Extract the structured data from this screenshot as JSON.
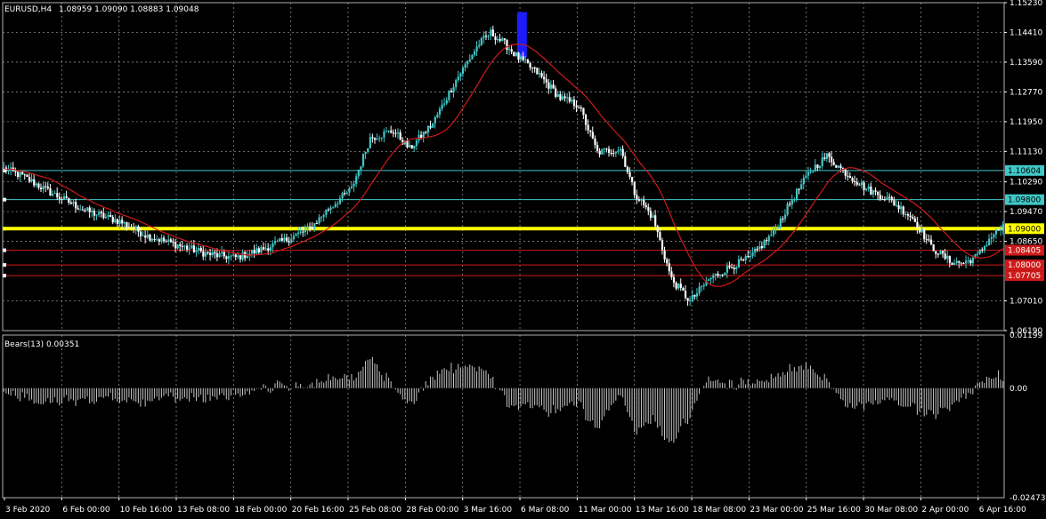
{
  "header": {
    "symbol_timeframe": "EURUSD,H4",
    "ohlc": "1.08959 1.09090 1.08883 1.09048"
  },
  "indicator": {
    "label": "Bears(13) 0.00351"
  },
  "colors": {
    "background": "#000000",
    "grid": "#8a8a8a",
    "bull": "#41c7c7",
    "bear": "#ffffff",
    "ma": "#d01a1a",
    "hline_cyan": "#41c7c7",
    "hline_yellow": "#ffff00",
    "hline_red": "#d01a1a",
    "highlight": "#1c1cff"
  },
  "chart_data": [
    {
      "type": "line",
      "series_kind": "candlestick",
      "ylim": [
        1.0619,
        1.1523
      ],
      "y_ticks": [
        "1.15230",
        "1.14410",
        "1.13590",
        "1.12770",
        "1.11950",
        "1.11130",
        "1.10290",
        "1.09470",
        "1.08650",
        "1.07010",
        "1.06190"
      ],
      "x_ticks": [
        "3 Feb 2020",
        "6 Feb 00:00",
        "10 Feb 16:00",
        "13 Feb 08:00",
        "18 Feb 00:00",
        "20 Feb 16:00",
        "25 Feb 08:00",
        "28 Feb 00:00",
        "3 Mar 16:00",
        "6 Mar 08:00",
        "11 Mar 00:00",
        "13 Mar 16:00",
        "18 Mar 08:00",
        "23 Mar 00:00",
        "25 Mar 16:00",
        "30 Mar 08:00",
        "2 Apr 00:00",
        "6 Apr 16:00"
      ],
      "anchors": [
        [
          0,
          1.1065
        ],
        [
          8,
          1.1045
        ],
        [
          20,
          1.1
        ],
        [
          35,
          1.095
        ],
        [
          50,
          1.092
        ],
        [
          62,
          1.088
        ],
        [
          75,
          1.0855
        ],
        [
          88,
          1.083
        ],
        [
          100,
          1.082
        ],
        [
          110,
          1.084
        ],
        [
          122,
          1.087
        ],
        [
          132,
          1.09
        ],
        [
          140,
          1.0955
        ],
        [
          150,
          1.101
        ],
        [
          158,
          1.115
        ],
        [
          168,
          1.117
        ],
        [
          175,
          1.112
        ],
        [
          185,
          1.119
        ],
        [
          195,
          1.131
        ],
        [
          205,
          1.141
        ],
        [
          210,
          1.144
        ],
        [
          216,
          1.141
        ],
        [
          222,
          1.137
        ],
        [
          230,
          1.133
        ],
        [
          240,
          1.126
        ],
        [
          248,
          1.124
        ],
        [
          256,
          1.111
        ],
        [
          266,
          1.112
        ],
        [
          272,
          1.1
        ],
        [
          280,
          1.093
        ],
        [
          288,
          1.076
        ],
        [
          296,
          1.07
        ],
        [
          304,
          1.076
        ],
        [
          312,
          1.079
        ],
        [
          322,
          1.082
        ],
        [
          332,
          1.089
        ],
        [
          340,
          1.098
        ],
        [
          348,
          1.106
        ],
        [
          355,
          1.11
        ],
        [
          362,
          1.106
        ],
        [
          372,
          1.101
        ],
        [
          382,
          1.098
        ],
        [
          392,
          1.093
        ],
        [
          400,
          1.085
        ],
        [
          408,
          1.081
        ],
        [
          414,
          1.0805
        ],
        [
          420,
          1.0825
        ],
        [
          426,
          1.088
        ],
        [
          431,
          1.0905
        ]
      ],
      "highlighted_bars": [
        222,
        225
      ],
      "moving_average": {
        "period": 21
      },
      "horizontal_lines": [
        {
          "value": 1.10604,
          "label": "1.10604",
          "color": "#41c7c7",
          "width": 1
        },
        {
          "value": 1.098,
          "label": "1.09800",
          "color": "#41c7c7",
          "width": 1
        },
        {
          "value": 1.09,
          "label": "1.09000",
          "color": "#ffff00",
          "width": 4
        },
        {
          "value": 1.08405,
          "label": "1.08405",
          "color": "#d01a1a",
          "width": 1
        },
        {
          "value": 1.08,
          "label": "1.08000",
          "color": "#d01a1a",
          "width": 1
        },
        {
          "value": 1.07705,
          "label": "1.07705",
          "color": "#d01a1a",
          "width": 1
        }
      ]
    },
    {
      "type": "bar",
      "name": "Bears(13)",
      "ylim": [
        -0.02473,
        0.01199
      ],
      "y_ticks": [
        "0.01199",
        "0.00",
        "-0.02473"
      ],
      "last_value": 0.00351
    }
  ]
}
